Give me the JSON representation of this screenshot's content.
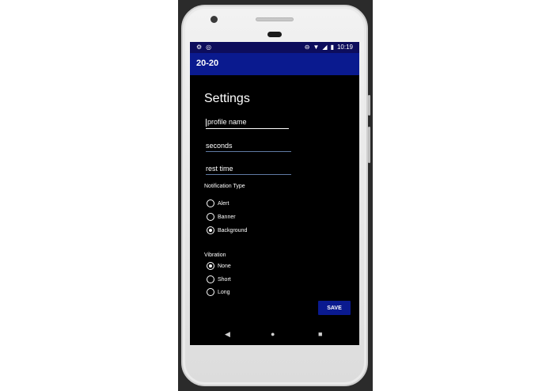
{
  "status_bar": {
    "time": "10:19",
    "left_icons": [
      "gear-icon",
      "record-icon"
    ],
    "right_icons": [
      "do-not-disturb-icon",
      "wifi-icon",
      "signal-icon",
      "battery-icon"
    ]
  },
  "app_bar": {
    "title": "20-20"
  },
  "settings": {
    "heading": "Settings",
    "profile_name_placeholder": "profile name",
    "seconds_placeholder": "seconds",
    "rest_time_placeholder": "rest time"
  },
  "notification": {
    "label": "Notification Type",
    "options": [
      {
        "label": "Alert",
        "checked": false
      },
      {
        "label": "Banner",
        "checked": false
      },
      {
        "label": "Background",
        "checked": true
      }
    ]
  },
  "vibration": {
    "label": "Vibration",
    "options": [
      {
        "label": "None",
        "checked": true
      },
      {
        "label": "Short",
        "checked": false
      },
      {
        "label": "Long",
        "checked": false
      }
    ]
  },
  "save_label": "SAVE",
  "nav": {
    "back": "◀",
    "home": "●",
    "recents": "■"
  },
  "colors": {
    "accent": "#0a1a8f",
    "status_bar": "#0d0d5c",
    "background": "#000000"
  }
}
